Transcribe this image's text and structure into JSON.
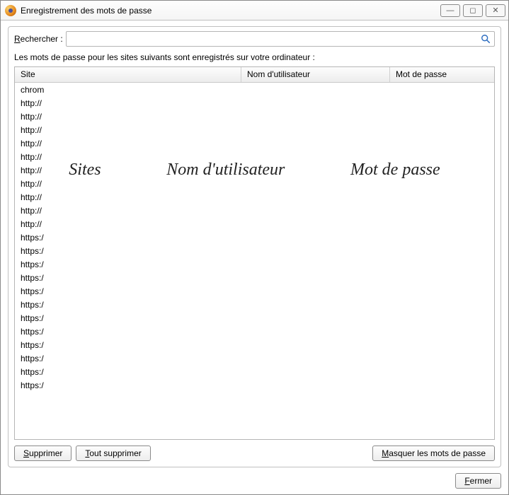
{
  "window": {
    "title": "Enregistrement des mots de passe",
    "minimize_glyph": "—",
    "maximize_glyph": "◻",
    "close_glyph": "✕"
  },
  "search": {
    "label_prefix_underlined": "R",
    "label_rest": "echercher :",
    "value": ""
  },
  "description": "Les mots de passe pour les sites suivants sont enregistrés sur votre ordinateur :",
  "columns": {
    "site": "Site",
    "user": "Nom d'utilisateur",
    "pass": "Mot de passe"
  },
  "rows": [
    {
      "site": "chrom",
      "user": "",
      "pass": ""
    },
    {
      "site": "http://",
      "user": "",
      "pass": ""
    },
    {
      "site": "http://",
      "user": "",
      "pass": ""
    },
    {
      "site": "http://",
      "user": "",
      "pass": ""
    },
    {
      "site": "http://",
      "user": "",
      "pass": ""
    },
    {
      "site": "http://",
      "user": "",
      "pass": ""
    },
    {
      "site": "http://",
      "user": "",
      "pass": ""
    },
    {
      "site": "http://",
      "user": "",
      "pass": ""
    },
    {
      "site": "http://",
      "user": "",
      "pass": ""
    },
    {
      "site": "http://",
      "user": "",
      "pass": ""
    },
    {
      "site": "http://",
      "user": "",
      "pass": ""
    },
    {
      "site": "https:/",
      "user": "",
      "pass": ""
    },
    {
      "site": "https:/",
      "user": "",
      "pass": ""
    },
    {
      "site": "https:/",
      "user": "",
      "pass": ""
    },
    {
      "site": "https:/",
      "user": "",
      "pass": ""
    },
    {
      "site": "https:/",
      "user": "",
      "pass": ""
    },
    {
      "site": "https:/",
      "user": "",
      "pass": ""
    },
    {
      "site": "https:/",
      "user": "",
      "pass": ""
    },
    {
      "site": "https:/",
      "user": "",
      "pass": ""
    },
    {
      "site": "https:/",
      "user": "",
      "pass": ""
    },
    {
      "site": "https:/",
      "user": "",
      "pass": ""
    },
    {
      "site": "https:/",
      "user": "",
      "pass": ""
    },
    {
      "site": "https:/",
      "user": "",
      "pass": ""
    }
  ],
  "overlay": {
    "sites": "Sites",
    "user": "Nom d'utilisateur",
    "pass": "Mot de passe"
  },
  "buttons": {
    "delete_u": "S",
    "delete_rest": "upprimer",
    "delete_all_u": "T",
    "delete_all_rest": "out supprimer",
    "mask_u": "M",
    "mask_rest": "asquer les mots de passe",
    "close_u": "F",
    "close_rest": "ermer"
  }
}
